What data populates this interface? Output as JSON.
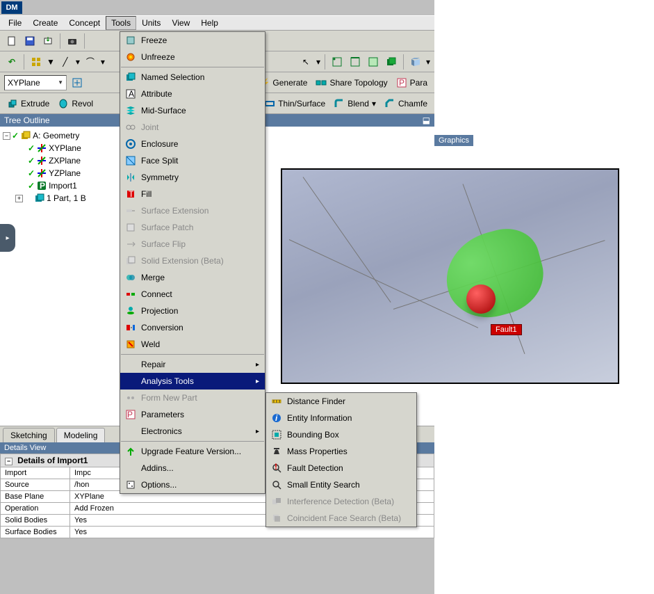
{
  "app": {
    "icon_text": "DM"
  },
  "menubar": [
    "File",
    "Create",
    "Concept",
    "Tools",
    "Units",
    "View",
    "Help"
  ],
  "menubar_open_index": 3,
  "plane_selector": "XYPlane",
  "toolbar3": {
    "extrude": "Extrude",
    "revolve": "Revol",
    "thin": "Thin/Surface",
    "blend": "Blend",
    "chamfer": "Chamfe",
    "generate": "Generate",
    "share_topology": "Share Topology",
    "params": "Para"
  },
  "tree": {
    "header": "Tree Outline",
    "root": "A: Geometry",
    "nodes": [
      "XYPlane",
      "ZXPlane",
      "YZPlane",
      "Import1",
      "1 Part, 1 B"
    ]
  },
  "tabs": {
    "sketching": "Sketching",
    "modeling": "Modeling"
  },
  "details": {
    "header": "Details View",
    "title": "Details of Import1",
    "rows": [
      {
        "k": "Import",
        "v": "Impc"
      },
      {
        "k": "Source",
        "v": "/hon"
      },
      {
        "k": "Base Plane",
        "v": "XYPlane"
      },
      {
        "k": "Operation",
        "v": "Add Frozen"
      },
      {
        "k": "Solid Bodies",
        "v": "Yes"
      },
      {
        "k": "Surface Bodies",
        "v": "Yes"
      }
    ]
  },
  "tools_menu": [
    {
      "label": "Freeze",
      "icon": "freeze-icon"
    },
    {
      "label": "Unfreeze",
      "icon": "unfreeze-icon"
    },
    {
      "sep": true
    },
    {
      "label": "Named Selection",
      "icon": "named-selection-icon"
    },
    {
      "label": "Attribute",
      "icon": "attribute-icon"
    },
    {
      "label": "Mid-Surface",
      "icon": "mid-surface-icon"
    },
    {
      "label": "Joint",
      "icon": "joint-icon",
      "disabled": true
    },
    {
      "label": "Enclosure",
      "icon": "enclosure-icon"
    },
    {
      "label": "Face Split",
      "icon": "face-split-icon"
    },
    {
      "label": "Symmetry",
      "icon": "symmetry-icon"
    },
    {
      "label": "Fill",
      "icon": "fill-icon"
    },
    {
      "label": "Surface Extension",
      "icon": "surface-extension-icon",
      "disabled": true
    },
    {
      "label": "Surface Patch",
      "icon": "surface-patch-icon",
      "disabled": true
    },
    {
      "label": "Surface Flip",
      "icon": "surface-flip-icon",
      "disabled": true
    },
    {
      "label": "Solid Extension (Beta)",
      "icon": "solid-extension-icon",
      "disabled": true
    },
    {
      "label": "Merge",
      "icon": "merge-icon"
    },
    {
      "label": "Connect",
      "icon": "connect-icon"
    },
    {
      "label": "Projection",
      "icon": "projection-icon"
    },
    {
      "label": "Conversion",
      "icon": "conversion-icon"
    },
    {
      "label": "Weld",
      "icon": "weld-icon"
    },
    {
      "sep": true
    },
    {
      "label": "Repair",
      "submenu": true
    },
    {
      "label": "Analysis Tools",
      "submenu": true,
      "highlighted": true
    },
    {
      "label": "Form New Part",
      "icon": "form-new-part-icon",
      "disabled": true
    },
    {
      "label": "Parameters",
      "icon": "parameters-icon"
    },
    {
      "label": "Electronics",
      "submenu": true
    },
    {
      "sep": true
    },
    {
      "label": "Upgrade Feature Version...",
      "icon": "upgrade-icon"
    },
    {
      "label": "Addins..."
    },
    {
      "label": "Options...",
      "icon": "options-icon"
    }
  ],
  "analysis_submenu": [
    {
      "label": "Distance Finder",
      "icon": "distance-finder-icon"
    },
    {
      "label": "Entity Information",
      "icon": "entity-info-icon"
    },
    {
      "label": "Bounding Box",
      "icon": "bounding-box-icon"
    },
    {
      "label": "Mass Properties",
      "icon": "mass-properties-icon"
    },
    {
      "label": "Fault Detection",
      "icon": "fault-detection-icon",
      "boxed": true
    },
    {
      "label": "Small Entity Search",
      "icon": "small-entity-search-icon"
    },
    {
      "label": "Interference Detection (Beta)",
      "icon": "interference-icon",
      "disabled": true
    },
    {
      "label": "Coincident Face Search (Beta)",
      "icon": "coincident-face-icon",
      "disabled": true
    }
  ],
  "graphics_label": "Graphics",
  "preview": {
    "fault_label": "Fault1"
  }
}
